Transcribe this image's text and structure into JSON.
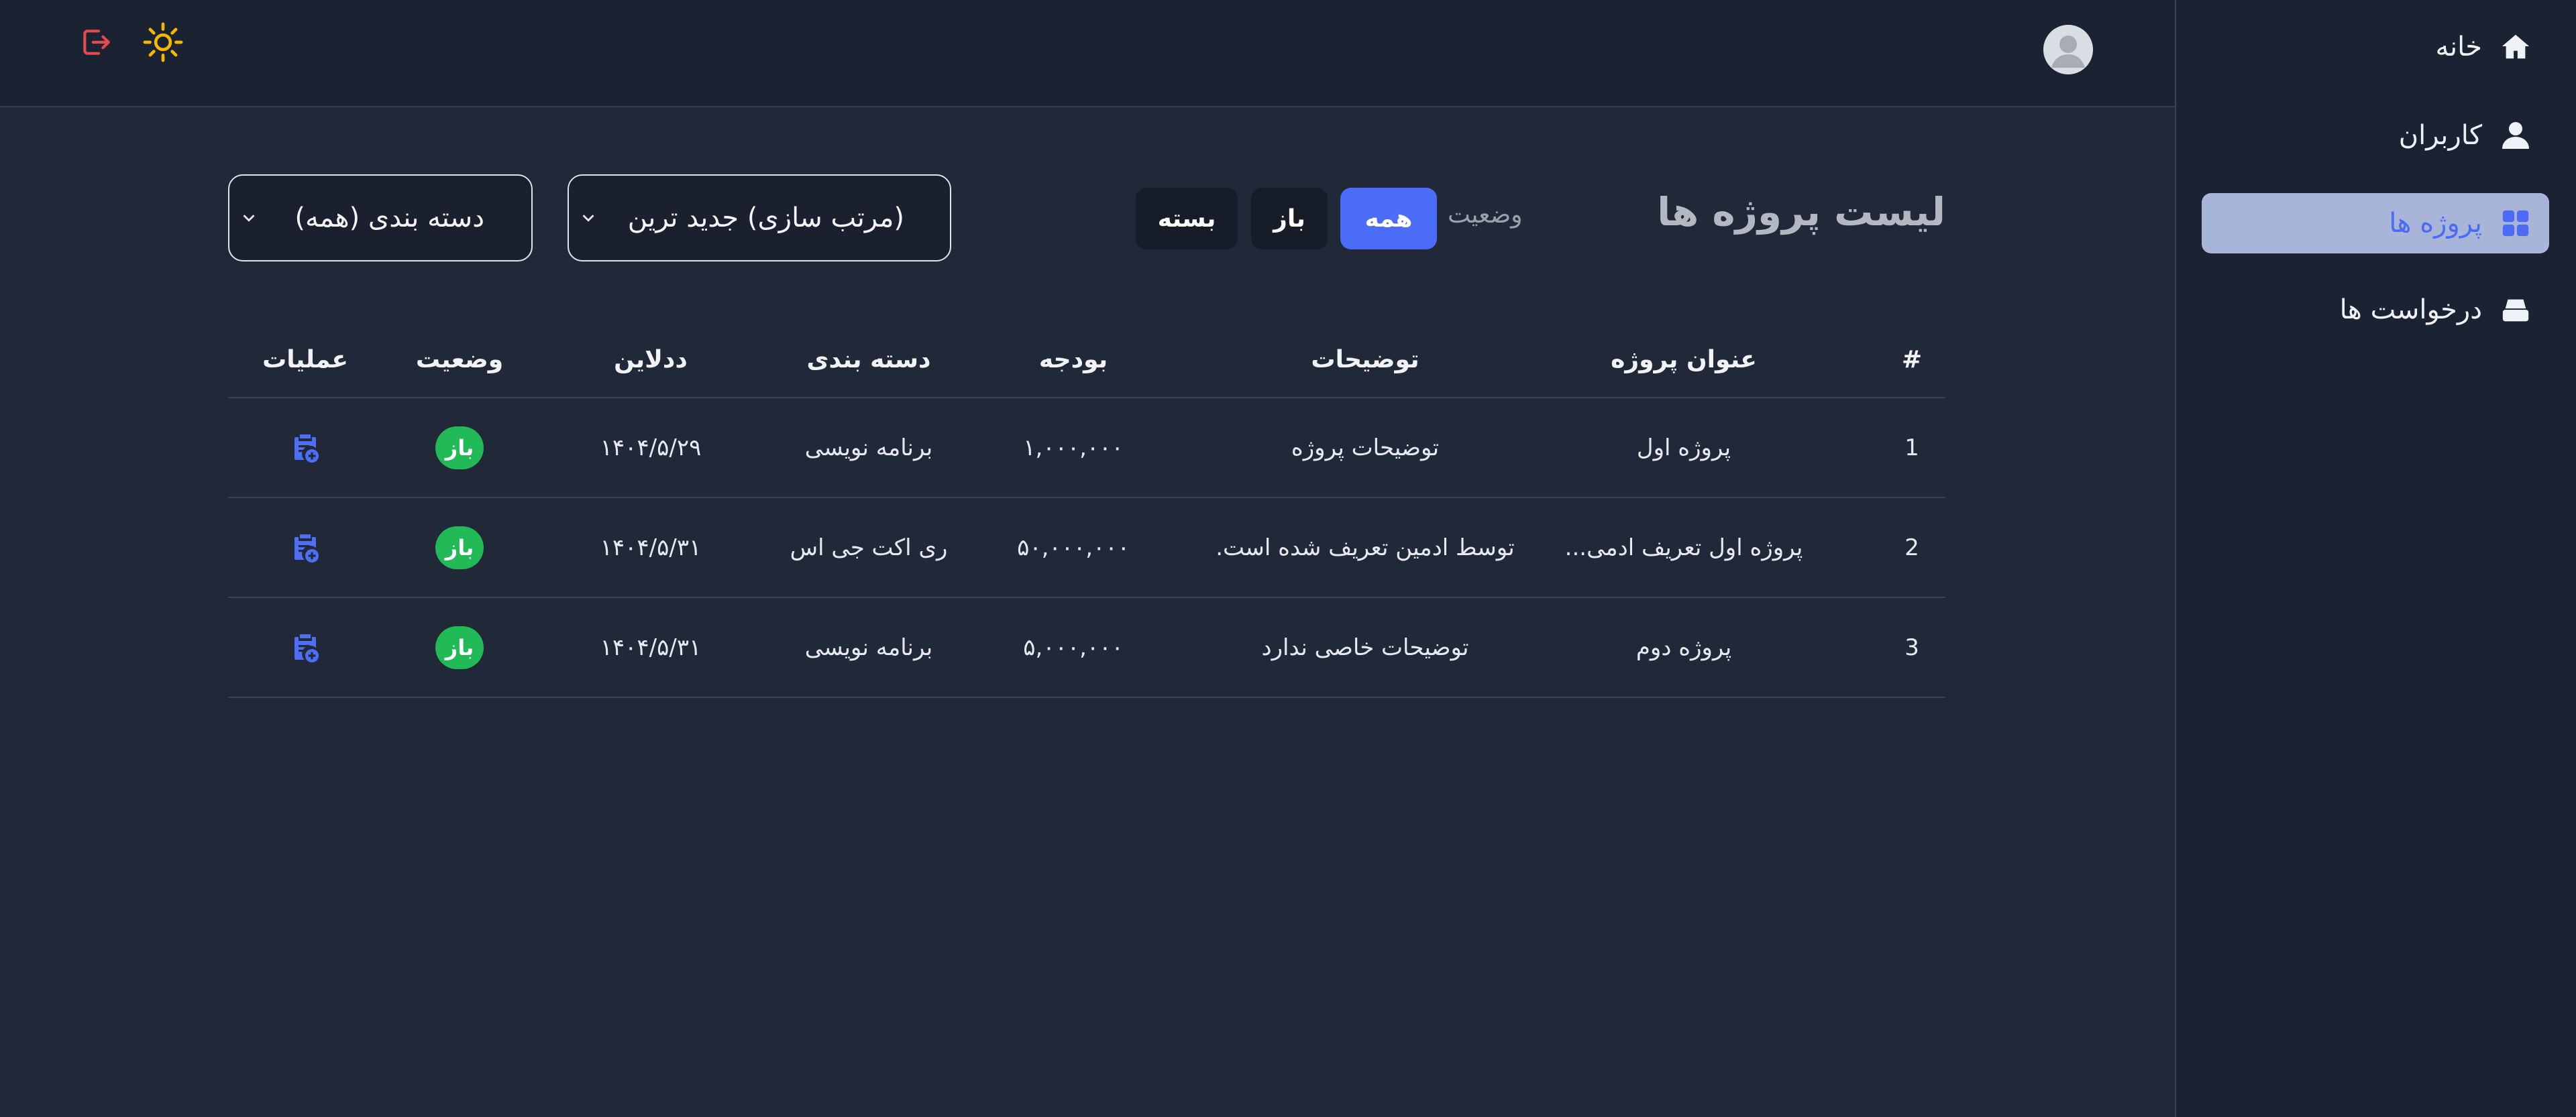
{
  "sidebar": {
    "items": [
      {
        "label": "خانه",
        "icon": "home-icon"
      },
      {
        "label": "کاربران",
        "icon": "user-icon"
      },
      {
        "label": "پروژه ها",
        "icon": "grid-icon",
        "active": true
      },
      {
        "label": "درخواست ها",
        "icon": "inbox-icon"
      }
    ]
  },
  "header": {
    "avatar": "avatar",
    "theme_icon": "sun-icon",
    "logout_icon": "logout-icon"
  },
  "toolbar": {
    "title": "لیست پروژه ها",
    "status_label": "وضعیت",
    "filters": {
      "all": "همه",
      "open": "باز",
      "closed": "بسته"
    },
    "active_filter": "all",
    "sort_select": "(مرتب سازی) جدید ترین",
    "category_select": "دسته بندی (همه)"
  },
  "table": {
    "headers": {
      "index": "#",
      "title": "عنوان پروژه",
      "description": "توضیحات",
      "budget": "بودجه",
      "category": "دسته بندی",
      "deadline": "ددلاین",
      "status": "وضعیت",
      "actions": "عملیات"
    },
    "rows": [
      {
        "index": "1",
        "title": "پروژه اول",
        "description": "توضیحات پروژه",
        "budget": "۱,۰۰۰,۰۰۰",
        "category": "برنامه نویسی",
        "deadline": "۱۴۰۴/۵/۲۹",
        "status": "باز"
      },
      {
        "index": "2",
        "title": "پروژه اول تعریف ادمی...",
        "description": "توسط ادمین تعریف شده است.",
        "budget": "۵۰,۰۰۰,۰۰۰",
        "category": "ری اکت جی اس",
        "deadline": "۱۴۰۴/۵/۳۱",
        "status": "باز"
      },
      {
        "index": "3",
        "title": "پروژه دوم",
        "description": "توضیحات خاصی ندارد",
        "budget": "۵,۰۰۰,۰۰۰",
        "category": "برنامه نویسی",
        "deadline": "۱۴۰۴/۵/۳۱",
        "status": "باز"
      }
    ]
  },
  "colors": {
    "background": "#212938",
    "sidebar": "#1b2231",
    "accent": "#4a6cf7",
    "active_nav_bg": "#a9b4d9",
    "open_badge": "#22b957",
    "logout": "#e5484d",
    "sun": "#f5b700"
  }
}
